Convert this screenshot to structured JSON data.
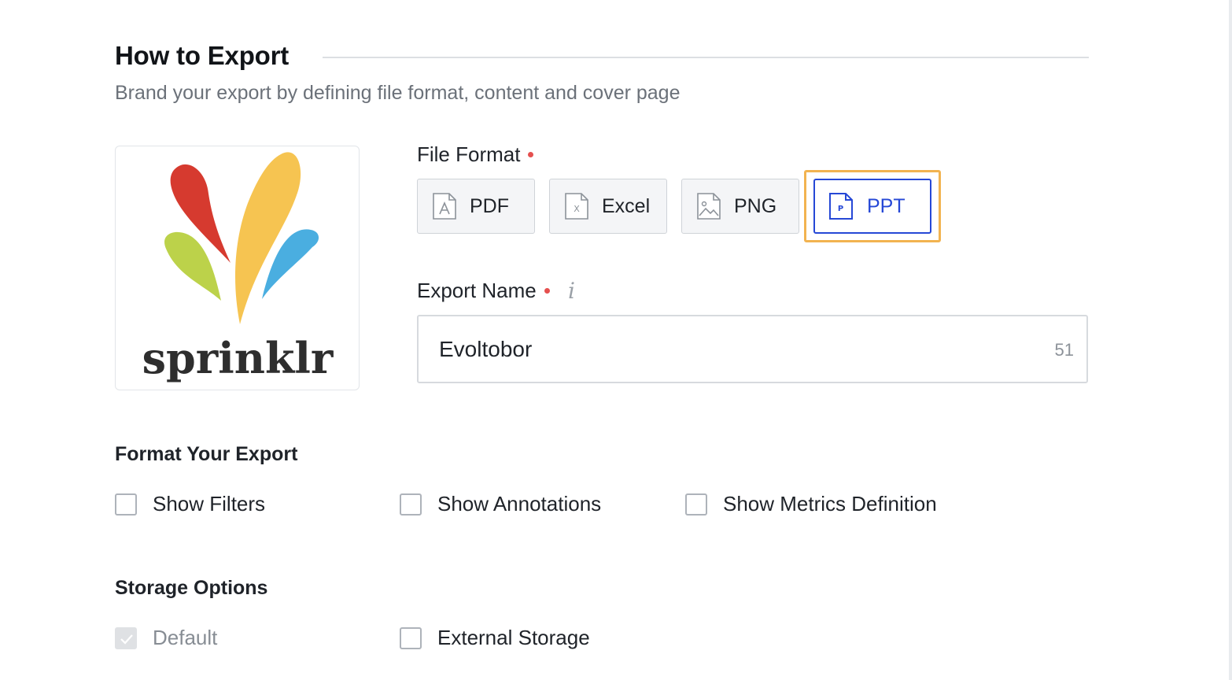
{
  "section": {
    "title": "How to Export",
    "subtitle": "Brand your export by defining file format, content and cover page"
  },
  "logo": {
    "brand_text": "sprinklr"
  },
  "file_format": {
    "label": "File Format",
    "required": true,
    "options": [
      {
        "label": "PDF",
        "icon": "pdf-file-icon",
        "selected": false
      },
      {
        "label": "Excel",
        "icon": "excel-file-icon",
        "selected": false
      },
      {
        "label": "PNG",
        "icon": "image-file-icon",
        "selected": false
      },
      {
        "label": "PPT",
        "icon": "ppt-file-icon",
        "selected": true
      }
    ],
    "selected_color": "#2648d6",
    "focus_color": "#f2b350"
  },
  "export_name": {
    "label": "Export Name",
    "required": true,
    "info_icon": "info-icon",
    "value": "Evoltobor",
    "char_count": "51"
  },
  "format_export": {
    "title": "Format Your Export",
    "options": [
      {
        "label": "Show Filters",
        "checked": false
      },
      {
        "label": "Show Annotations",
        "checked": false
      },
      {
        "label": "Show Metrics Definition",
        "checked": false
      }
    ]
  },
  "storage": {
    "title": "Storage Options",
    "options": [
      {
        "label": "Default",
        "checked": true,
        "disabled": true
      },
      {
        "label": "External Storage",
        "checked": false
      }
    ]
  },
  "colors": {
    "required_dot": "#e5504f"
  }
}
